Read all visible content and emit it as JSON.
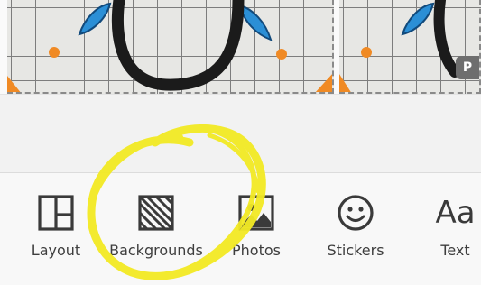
{
  "preview": {
    "badge_label": "P"
  },
  "toolbar": {
    "items": [
      {
        "label": "Layout",
        "icon": "layout-icon"
      },
      {
        "label": "Backgrounds",
        "icon": "backgrounds-icon"
      },
      {
        "label": "Photos",
        "icon": "photo-icon"
      },
      {
        "label": "Stickers",
        "icon": "smiley-icon"
      },
      {
        "label": "Text",
        "icon": "text-icon",
        "glyph": "Aa"
      }
    ]
  },
  "colors": {
    "highlighter": "#f3ea24",
    "icon": "#3a3a3a",
    "label": "#3e3e3e",
    "marker_blue": "#2b8fd6",
    "marker_orange": "#f08a24"
  }
}
